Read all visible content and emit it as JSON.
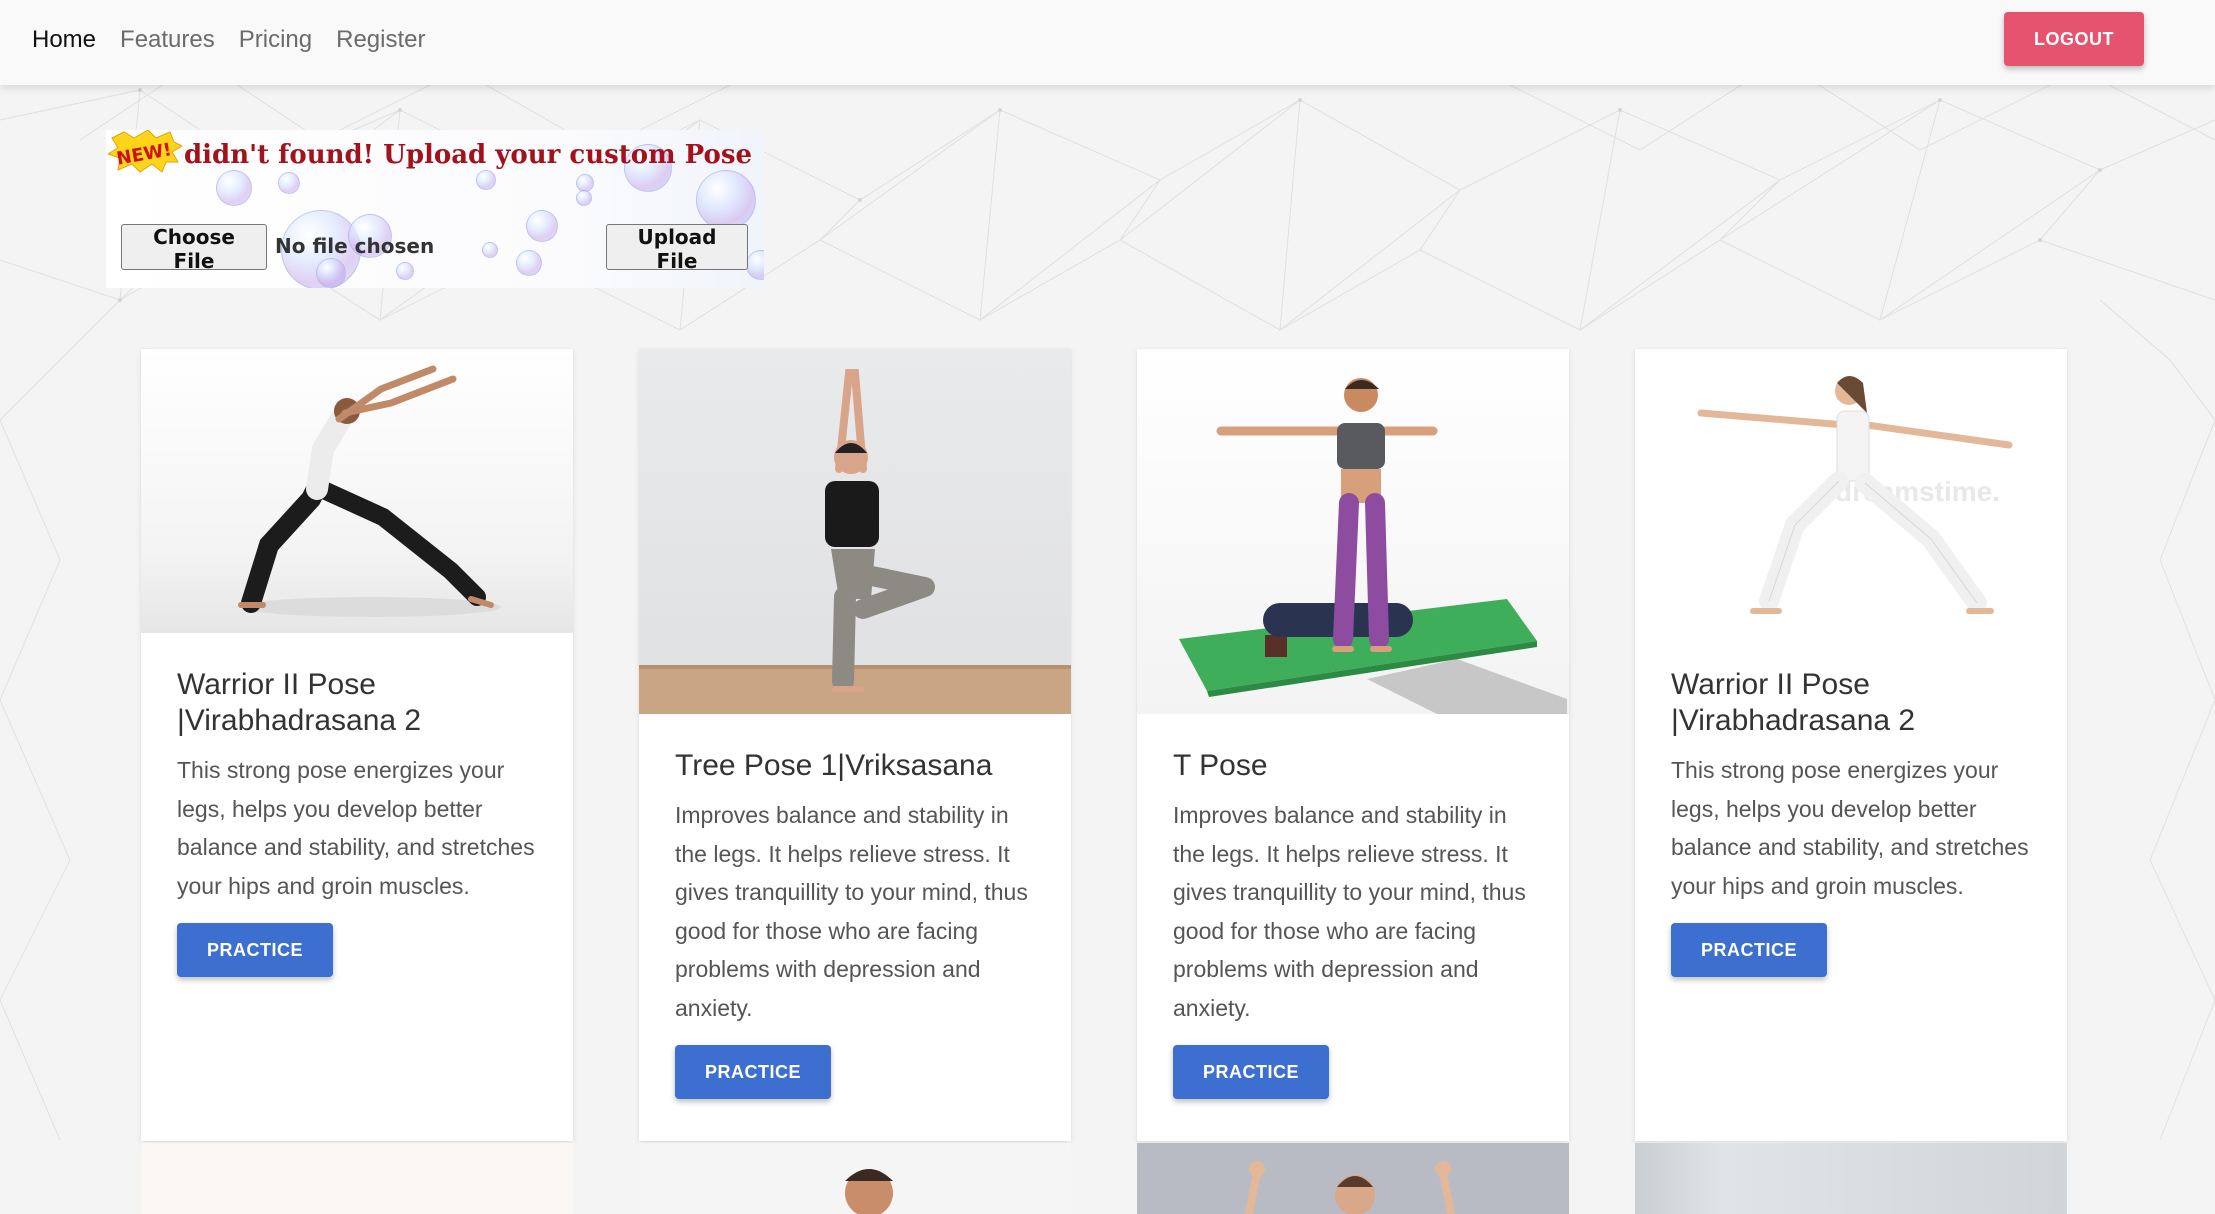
{
  "nav": {
    "links": [
      "Home",
      "Features",
      "Pricing",
      "Register"
    ],
    "active_index": 0,
    "logout_label": "LOGOUT"
  },
  "upload": {
    "badge_text": "NEW!",
    "title": "didn't found! Upload your custom Pose",
    "choose_file_label": "Choose File",
    "file_status": "No file chosen",
    "upload_label": "Upload File"
  },
  "watermark": "dreamstime.",
  "cards": [
    {
      "title": "Warrior II Pose |Virabhadrasana 2",
      "description": "This strong pose energizes your legs, helps you develop better balance and stability, and stretches your hips and groin muscles.",
      "button_label": "PRACTICE",
      "image": "warrior-pose-photo"
    },
    {
      "title": "Tree Pose 1|Vriksasana",
      "description": "Improves balance and stability in the legs. It helps relieve stress. It gives tranquillity to your mind, thus good for those who are facing problems with depression and anxiety.",
      "button_label": "PRACTICE",
      "image": "tree-pose-photo"
    },
    {
      "title": "T Pose",
      "description": "Improves balance and stability in the legs. It helps relieve stress. It gives tranquillity to your mind, thus good for those who are facing problems with depression and anxiety.",
      "button_label": "PRACTICE",
      "image": "t-pose-render"
    },
    {
      "title": "Warrior II Pose |Virabhadrasana 2",
      "description": "This strong pose energizes your legs, helps you develop better balance and stability, and stretches your hips and groin muscles.",
      "button_label": "PRACTICE",
      "image": "warrior-pose-white-photo"
    }
  ],
  "colors": {
    "logout": "#e5536e",
    "practice": "#3c6fcf",
    "upload_title": "#a3121c"
  }
}
